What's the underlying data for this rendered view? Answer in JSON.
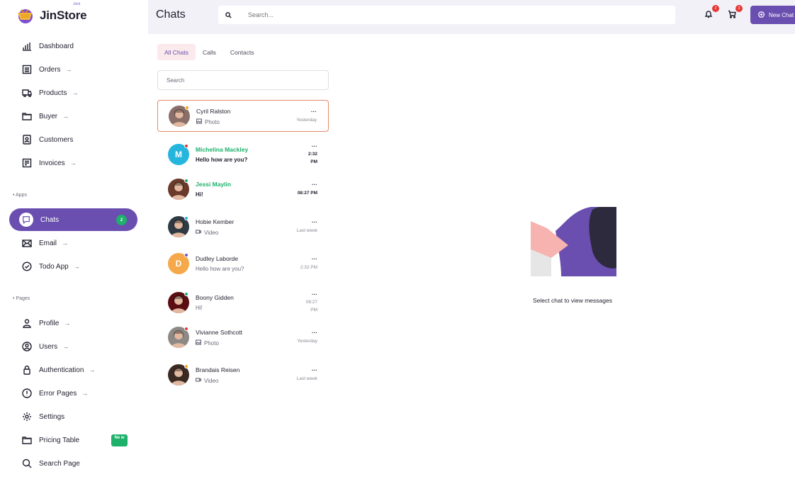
{
  "brand": {
    "name": "JinStore",
    "tag": "Jekit"
  },
  "sidebar": {
    "items": [
      {
        "label": "Dashboard",
        "icon": "bar-chart-icon",
        "arrow": ""
      },
      {
        "label": "Orders",
        "icon": "list-icon",
        "arrow": "→"
      },
      {
        "label": "Products",
        "icon": "truck-icon",
        "arrow": "→"
      },
      {
        "label": "Buyer",
        "icon": "folder-icon",
        "arrow": "→"
      },
      {
        "label": "Customers",
        "icon": "contact-icon",
        "arrow": ""
      },
      {
        "label": "Invoices",
        "icon": "invoice-icon",
        "arrow": "→"
      }
    ],
    "apps_label": "• Apps",
    "apps": [
      {
        "label": "Chats",
        "icon": "chat-icon",
        "badge": "2"
      },
      {
        "label": "Email",
        "icon": "mail-icon",
        "arrow": "→"
      },
      {
        "label": "Todo App",
        "icon": "check-circle-icon",
        "arrow": "→"
      }
    ],
    "pages_label": "• Pages",
    "pages": [
      {
        "label": "Profile",
        "icon": "user-icon",
        "arrow": "→"
      },
      {
        "label": "Users",
        "icon": "user-circle-icon",
        "arrow": "→"
      },
      {
        "label": "Authentication",
        "icon": "lock-icon",
        "arrow": "→"
      },
      {
        "label": "Error Pages",
        "icon": "alert-icon",
        "arrow": "→"
      },
      {
        "label": "Settings",
        "icon": "gear-icon",
        "arrow": ""
      },
      {
        "label": "Pricing Table",
        "icon": "folder-icon",
        "badge": "Ne w"
      },
      {
        "label": "Search Page",
        "icon": "search-icon",
        "arrow": ""
      }
    ]
  },
  "header": {
    "title": "Chats",
    "search_placeholder": "Search...",
    "notifications_count": "2",
    "cart_count": "3",
    "new_chat_label": "New Chat"
  },
  "chat_list": {
    "tabs": [
      "All Chats",
      "Calls",
      "Contacts"
    ],
    "search_placeholder": "Search",
    "chats": [
      {
        "name": "Cyril Ralston",
        "message": "Photo",
        "type": "photo",
        "time": "Yesterday",
        "unread": false,
        "status_color": "#f5a623",
        "avatar_letter": "",
        "avatar_color": "#8a6f68",
        "more": "..."
      },
      {
        "name": "Michelina Mackley",
        "message": "Hello how are you?",
        "type": "text",
        "time_lines": [
          "2:32",
          "PM"
        ],
        "unread": true,
        "status_color": "#e53935",
        "avatar_letter": "M",
        "avatar_color": "#26b6dd",
        "more": "..."
      },
      {
        "name": "Jessi Maylin",
        "message": "Hi!",
        "type": "text",
        "time": "08:27 PM",
        "unread": true,
        "status_color": "#1db16b",
        "avatar_letter": "",
        "avatar_color": "#6b3a2a",
        "more": "..."
      },
      {
        "name": "Hobie Kember",
        "message": "Video",
        "type": "video",
        "time": "Last week",
        "unread": false,
        "status_color": "#26b6dd",
        "avatar_letter": "",
        "avatar_color": "#2f3a44",
        "more": "..."
      },
      {
        "name": "Dudley Laborde",
        "message": "Hello how are you?",
        "type": "text",
        "time": "2:32 PM",
        "unread": false,
        "status_color": "#7b4fd3",
        "avatar_letter": "D",
        "avatar_color": "#f5a94a",
        "more": "..."
      },
      {
        "name": "Boony Gidden",
        "message": "Hi!",
        "type": "text",
        "time_lines": [
          "08:27",
          "PM"
        ],
        "unread": false,
        "status_color": "#1db16b",
        "avatar_letter": "",
        "avatar_color": "#5a0e12",
        "more": "..."
      },
      {
        "name": "Vivianne Sothcott",
        "message": "Photo",
        "type": "photo",
        "time": "Yesterday",
        "unread": false,
        "status_color": "#e53935",
        "avatar_letter": "",
        "avatar_color": "#8d8a86",
        "more": "..."
      },
      {
        "name": "Brandais Reisen",
        "message": "Video",
        "type": "video",
        "time": "Last week",
        "unread": false,
        "status_color": "#f5a623",
        "avatar_letter": "",
        "avatar_color": "#3a2a22",
        "more": "..."
      }
    ]
  },
  "empty_state": {
    "text": "Select chat to view messages"
  },
  "colors": {
    "accent": "#6a4fb0",
    "success": "#1db16b",
    "danger": "#e53935",
    "selected_border": "#e58a6e",
    "tab_active_bg": "#fbe9ec"
  }
}
